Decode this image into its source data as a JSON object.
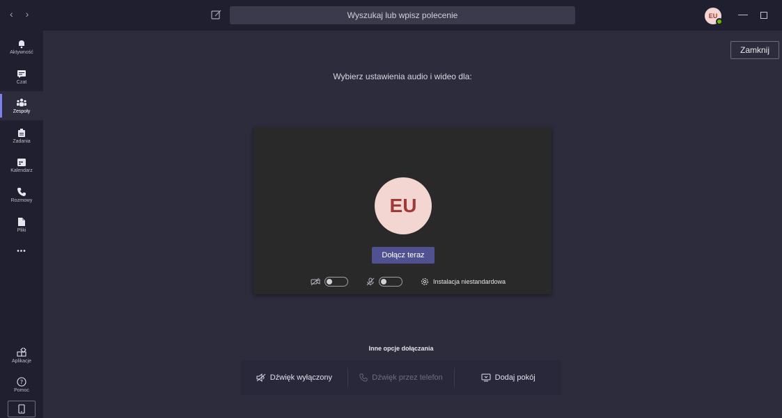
{
  "topbar": {
    "back_glyph": "‹",
    "forward_glyph": "›",
    "search_placeholder": "Wyszukaj lub wpisz polecenie",
    "avatar_initials": "EU",
    "minimize_glyph": "—"
  },
  "rail": {
    "items": [
      {
        "label": "Aktywność",
        "icon": "bell-icon"
      },
      {
        "label": "Czat",
        "icon": "chat-icon"
      },
      {
        "label": "Zespoły",
        "icon": "teams-icon",
        "active": true
      },
      {
        "label": "Zadania",
        "icon": "assignments-icon"
      },
      {
        "label": "Kalendarz",
        "icon": "calendar-icon"
      },
      {
        "label": "Rozmowy",
        "icon": "phone-icon"
      },
      {
        "label": "Pliki",
        "icon": "file-icon"
      }
    ],
    "more_glyph": "•••",
    "bottom": [
      {
        "label": "Aplikacje",
        "icon": "apps-icon"
      },
      {
        "label": "Pomoc",
        "icon": "help-icon"
      }
    ]
  },
  "main": {
    "close_label": "Zamknij",
    "heading": "Wybierz ustawienia audio i wideo dla:",
    "avatar_initials": "EU",
    "join_label": "Dołącz teraz",
    "custom_setup_label": "Instalacja niestandardowa",
    "other_options_title": "Inne opcje dołączania",
    "options": [
      {
        "label": "Dźwięk wyłączony",
        "icon": "speaker-off-icon"
      },
      {
        "label": "Dźwięk przez telefon",
        "icon": "phone-icon",
        "disabled": true
      },
      {
        "label": "Dodaj pokój",
        "icon": "cast-icon"
      }
    ]
  },
  "colors": {
    "background": "#2d2c3c",
    "rail": "#201f2f",
    "accent": "#4f5190",
    "avatar_bg": "#f3d6d2",
    "avatar_fg": "#a03a37",
    "presence": "#6bb700"
  }
}
